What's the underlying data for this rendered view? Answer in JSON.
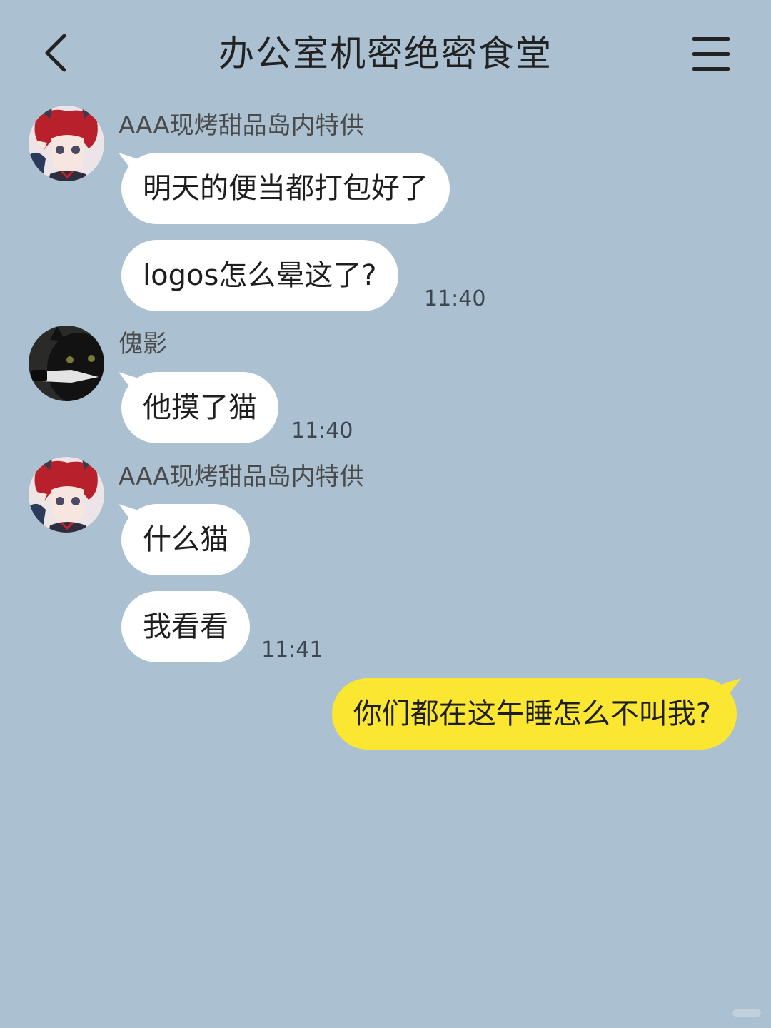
{
  "header": {
    "title": "办公室机密绝密食堂",
    "back_icon": "chevron-left-icon",
    "menu_icon": "hamburger-menu-icon"
  },
  "messages": [
    {
      "sender": "AAA现烤甜品岛内特供",
      "avatar": "red-haired-anime-character-avatar",
      "bubbles": [
        "明天的便当都打包好了",
        "logos怎么晕这了?"
      ],
      "time": "11:40"
    },
    {
      "sender": "傀影",
      "avatar": "black-cat-holding-knife-avatar",
      "bubbles": [
        "他摸了猫"
      ],
      "time": "11:40"
    },
    {
      "sender": "AAA现烤甜品岛内特供",
      "avatar": "red-haired-anime-character-avatar",
      "bubbles": [
        "什么猫",
        "我看看"
      ],
      "time": "11:41"
    }
  ],
  "outgoing": {
    "text": "你们都在这午睡怎么不叫我?"
  },
  "colors": {
    "background": "#abc1d1",
    "incoming_bubble": "#ffffff",
    "outgoing_bubble": "#fbe732",
    "text": "#1e1e1e"
  }
}
